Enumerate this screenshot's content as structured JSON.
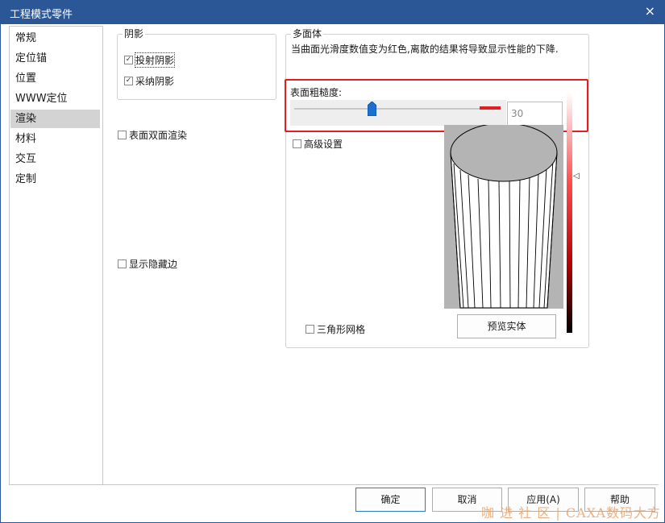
{
  "window": {
    "title": "工程模式零件",
    "close_glyph": "×"
  },
  "nav": {
    "items": [
      {
        "label": "常规"
      },
      {
        "label": "定位锚"
      },
      {
        "label": "位置"
      },
      {
        "label": "WWW定位"
      },
      {
        "label": "渲染",
        "selected": true
      },
      {
        "label": "材料"
      },
      {
        "label": "交互"
      },
      {
        "label": "定制"
      }
    ]
  },
  "shadow": {
    "title": "阴影",
    "cast": {
      "label": "投射阴影",
      "checked": true
    },
    "receive": {
      "label": "采纳阴影",
      "checked": true
    }
  },
  "double_sided": {
    "label": "表面双面渲染",
    "checked": false
  },
  "show_hidden_edges": {
    "label": "显示隐藏边",
    "checked": false
  },
  "polyhedron": {
    "title": "多面体",
    "note": "当曲面光滑度数值变为红色,离散的结果将导致显示性能的下降.",
    "roughness_label": "表面粗糙度:",
    "roughness_value": "30",
    "roughness_level": 0.37,
    "advanced": {
      "label": "高级设置",
      "checked": false
    },
    "triangle_mesh": {
      "label": "三角形网格",
      "checked": false
    },
    "preview_button": "预览实体",
    "gradient_marker_glyph": "◁",
    "highlight_color": "#e02020"
  },
  "buttons": {
    "ok": "确定",
    "cancel": "取消",
    "apply": "应用(A)",
    "help": "帮助"
  },
  "watermark": "咖 进 社 区 | CAXA数码大方",
  "colors": {
    "titlebar": "#2b5797",
    "selected_nav": "#d3d3d3",
    "preview_bg": "#b4b4b4"
  }
}
